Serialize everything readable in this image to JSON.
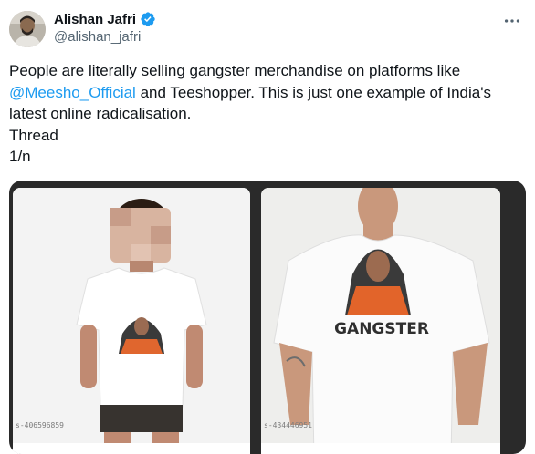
{
  "author": {
    "name": "Alishan Jafri",
    "handle": "@alishan_jafri",
    "verified_color": "#1d9bf0"
  },
  "tweet": {
    "text_before": "People are literally selling gangster merchandise on platforms like ",
    "mention": "@Meesho_Official",
    "text_after": " and Teeshopper. This is just one example of India's latest online radicalisation.\nThread\n1/n"
  },
  "media": {
    "left": {
      "product_code": "s-406596859"
    },
    "right": {
      "product_code": "s-434446951",
      "shirt_print": "GANGSTER"
    }
  },
  "icons": {
    "more": "more-dots-icon",
    "verified": "verified-badge-icon"
  }
}
